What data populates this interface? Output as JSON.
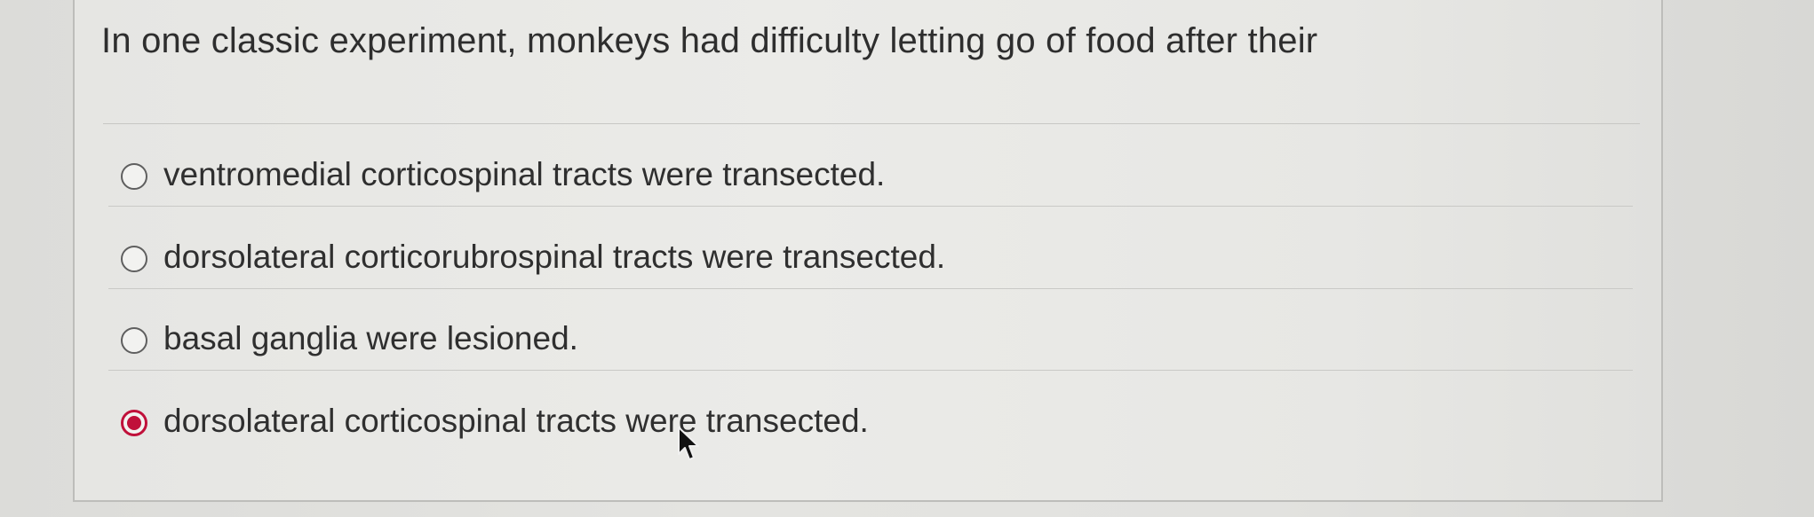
{
  "question": {
    "text": "In one classic experiment, monkeys had difficulty letting go of food after their"
  },
  "options": [
    {
      "label": "ventromedial corticospinal tracts were transected.",
      "selected": false
    },
    {
      "label": "dorsolateral corticorubrospinal tracts were transected.",
      "selected": false
    },
    {
      "label": "basal ganglia were lesioned.",
      "selected": false
    },
    {
      "label": "dorsolateral corticospinal tracts were transected.",
      "selected": true
    }
  ],
  "colors": {
    "selected_radio": "#c0103a",
    "text": "#2f2f2f",
    "card_border": "#bdbdba"
  },
  "icons": {
    "pointer": "mouse-pointer-icon"
  }
}
